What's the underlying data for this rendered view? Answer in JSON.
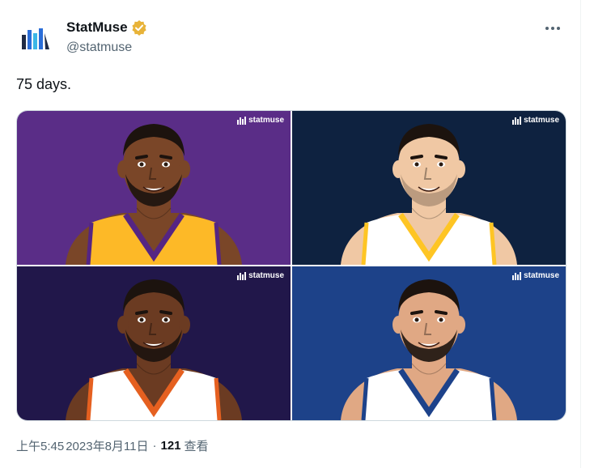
{
  "tweet": {
    "display_name": "StatMuse",
    "handle": "@statmuse",
    "text": "75 days.",
    "time": "上午5:45",
    "separator": "·",
    "date": "2023年8月11日",
    "views_count": "121",
    "views_label": "查看"
  },
  "media": {
    "watermark": "statmuse",
    "tiles": [
      {
        "bg": "#5a2d87",
        "skin": "#7a4628",
        "jersey": "#fdb927",
        "trim": "#552583"
      },
      {
        "bg": "#0e2240",
        "skin": "#f0c8a4",
        "jersey": "#ffffff",
        "trim": "#fec524"
      },
      {
        "bg": "#21174a",
        "skin": "#6b3b22",
        "jersey": "#ffffff",
        "trim": "#e56020"
      },
      {
        "bg": "#1d4289",
        "skin": "#e0a884",
        "jersey": "#ffffff",
        "trim": "#1d428a"
      }
    ]
  },
  "colors": {
    "text_primary": "#0f1419",
    "text_secondary": "#536471",
    "verified_gold": "#e8b339",
    "logo_blue": "#2a6dd8"
  }
}
